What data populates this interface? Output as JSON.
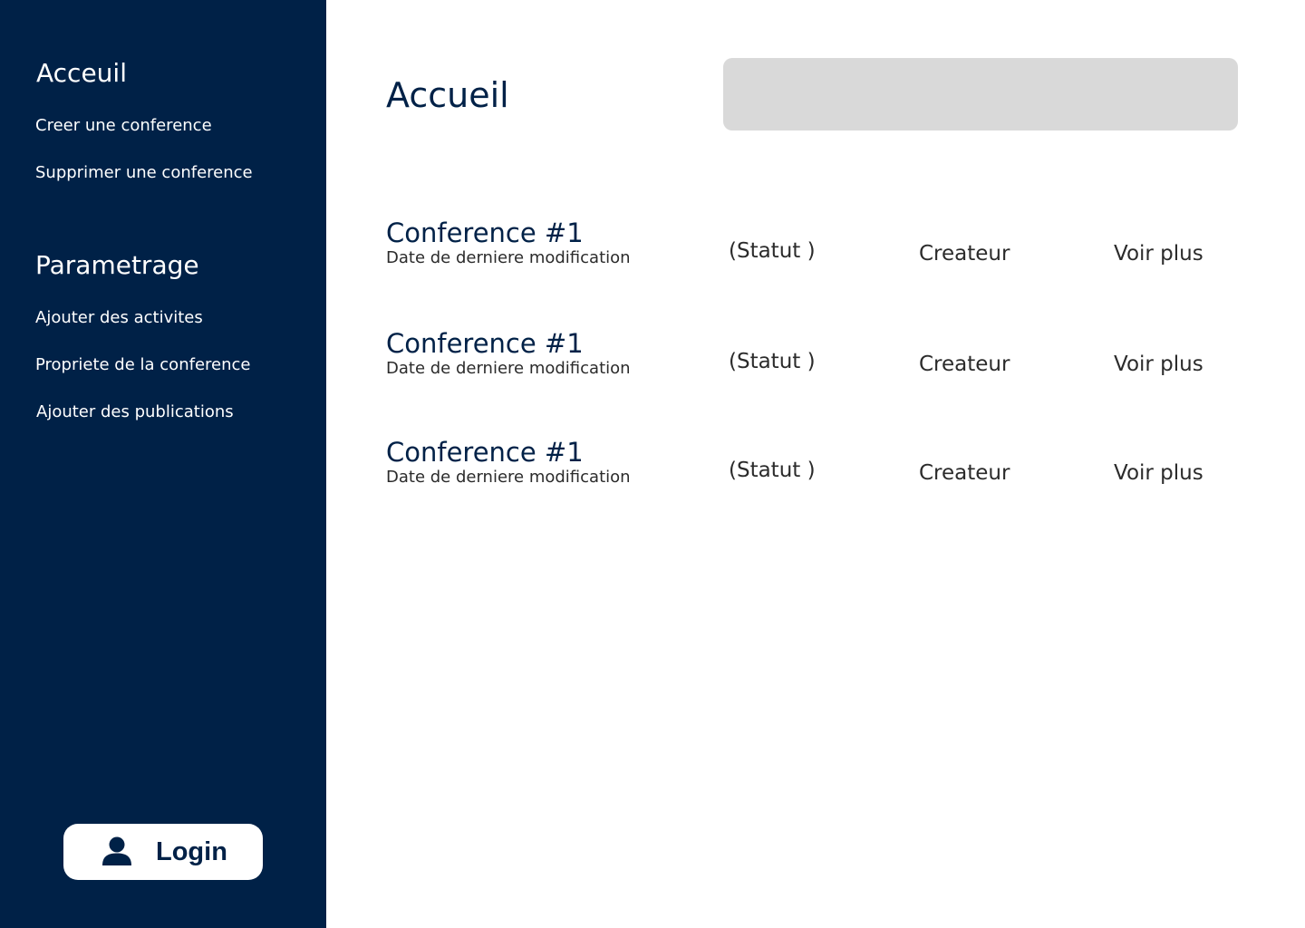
{
  "sidebar": {
    "section_home": {
      "heading": "Acceuil",
      "items": [
        {
          "label": "Creer une conference"
        },
        {
          "label": "Supprimer une conference"
        }
      ]
    },
    "section_settings": {
      "heading": "Parametrage",
      "items": [
        {
          "label": "Ajouter des activites"
        },
        {
          "label": "Propriete de la conference"
        },
        {
          "label": "Ajouter des publications"
        }
      ]
    },
    "login": {
      "label": "Login",
      "icon": "user-icon"
    }
  },
  "main": {
    "title": "Accueil",
    "search": {
      "value": "",
      "placeholder": ""
    },
    "conferences": [
      {
        "title": "Conference #1",
        "date_label": "Date de derniere modification",
        "status": "(Statut )",
        "creator": "Createur",
        "more": "Voir plus"
      },
      {
        "title": "Conference #1",
        "date_label": "Date de derniere modification",
        "status": "(Statut )",
        "creator": "Createur",
        "more": "Voir plus"
      },
      {
        "title": "Conference #1",
        "date_label": "Date de derniere modification",
        "status": "(Statut )",
        "creator": "Createur",
        "more": "Voir plus"
      }
    ]
  },
  "colors": {
    "sidebar_bg": "#002147",
    "accent_text": "#002147",
    "search_bg": "#d9d9d9",
    "body_text": "#2b2b2b"
  }
}
